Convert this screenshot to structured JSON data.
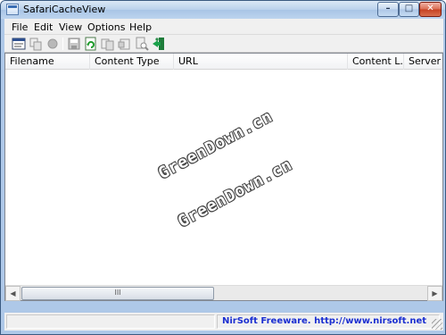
{
  "window": {
    "title": "SafariCacheView",
    "controls": {
      "minimize": "–",
      "maximize": "□",
      "close": "✕"
    }
  },
  "menu": {
    "items": [
      "File",
      "Edit",
      "View",
      "Options",
      "Help"
    ]
  },
  "toolbar": {
    "icons": [
      "properties-icon",
      "copy-icon",
      "stop-icon",
      "save-icon",
      "refresh-icon",
      "copy-selected-icon",
      "html-report-icon",
      "find-icon",
      "exit-icon"
    ]
  },
  "list": {
    "columns": [
      "Filename",
      "Content Type",
      "URL",
      "Content L...",
      "Server N"
    ],
    "rows": []
  },
  "watermarks": [
    "GreenDown.cn",
    "GreenDown.cn"
  ],
  "scrollbar": {
    "thumb_grip": "III"
  },
  "status": {
    "text": "NirSoft Freeware.  http://www.nirsoft.net"
  },
  "colors": {
    "title_bar": "#b9d1ec",
    "status_link": "#1b2fd1",
    "close_button": "#c64020"
  }
}
